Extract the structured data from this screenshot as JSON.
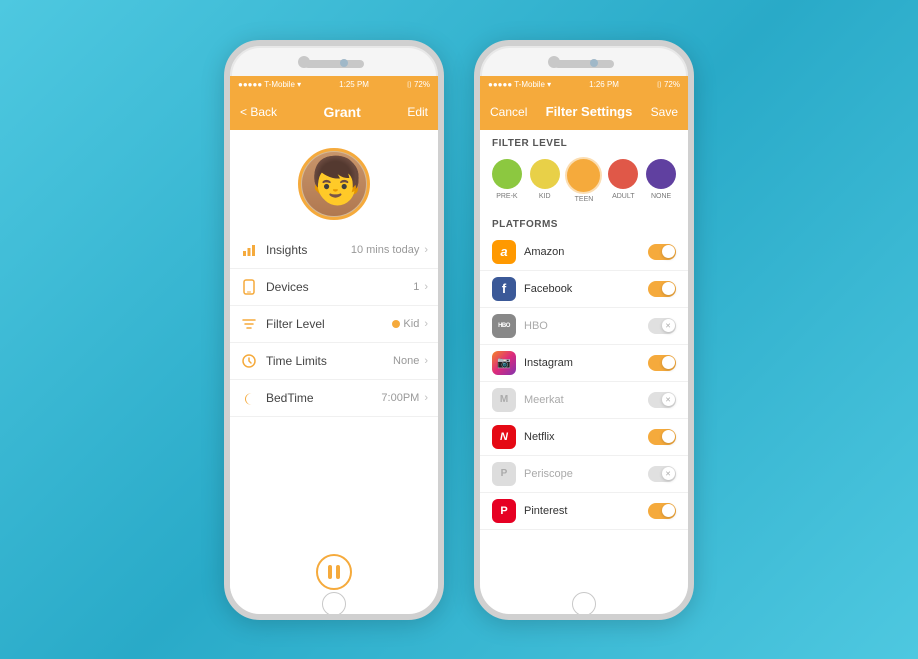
{
  "background": "#4ec8e0",
  "phone_left": {
    "status_bar": {
      "carrier": "●●●●● T-Mobile ▾",
      "time": "1:25 PM",
      "battery": "⌷ 72%"
    },
    "nav": {
      "back_label": "< Back",
      "title": "Grant",
      "action": "Edit"
    },
    "profile_name": "Grant",
    "menu_items": [
      {
        "icon": "chart-icon",
        "label": "Insights",
        "value": "10 mins today",
        "has_chevron": true
      },
      {
        "icon": "phone-icon",
        "label": "Devices",
        "value": "1",
        "has_chevron": true
      },
      {
        "icon": "filter-icon",
        "label": "Filter Level",
        "value": "Kid",
        "has_dot": true,
        "has_chevron": true
      },
      {
        "icon": "clock-icon",
        "label": "Time Limits",
        "value": "None",
        "has_chevron": true
      },
      {
        "icon": "moon-icon",
        "label": "BedTime",
        "value": "7:00PM",
        "has_chevron": true
      }
    ]
  },
  "phone_right": {
    "status_bar": {
      "carrier": "●●●●● T-Mobile ▾",
      "time": "1:26 PM",
      "battery": "⌷ 72%"
    },
    "nav": {
      "cancel_label": "Cancel",
      "title": "Filter Settings",
      "save_label": "Save"
    },
    "filter_level_header": "FILTER LEVEL",
    "levels": [
      {
        "id": "pre-k",
        "label": "PRE-K",
        "color": "#8cc840",
        "selected": false
      },
      {
        "id": "kid",
        "label": "KID",
        "color": "#e8d048",
        "selected": false
      },
      {
        "id": "teen",
        "label": "TEEN",
        "color": "#f5aa3c",
        "selected": true
      },
      {
        "id": "adult",
        "label": "ADULT",
        "color": "#e05848",
        "selected": false
      },
      {
        "id": "none",
        "label": "NONE",
        "color": "#6040a0",
        "selected": false
      }
    ],
    "platforms_header": "PLATFORMS",
    "platforms": [
      {
        "name": "Amazon",
        "icon_text": "a",
        "icon_bg": "#ff9900",
        "enabled": true,
        "disabled": false
      },
      {
        "name": "Facebook",
        "icon_text": "f",
        "icon_bg": "#3b5998",
        "enabled": true,
        "disabled": false
      },
      {
        "name": "HBO",
        "icon_text": "HBO",
        "icon_bg": "#aaaaaa",
        "enabled": false,
        "disabled": true
      },
      {
        "name": "Instagram",
        "icon_text": "📷",
        "icon_bg": "#c13584",
        "enabled": true,
        "disabled": false
      },
      {
        "name": "Meerkat",
        "icon_text": "M",
        "icon_bg": "#cccccc",
        "enabled": false,
        "disabled": true
      },
      {
        "name": "Netflix",
        "icon_text": "N",
        "icon_bg": "#e50914",
        "enabled": true,
        "disabled": false
      },
      {
        "name": "Periscope",
        "icon_text": "P",
        "icon_bg": "#cccccc",
        "enabled": false,
        "disabled": true
      },
      {
        "name": "Pinterest",
        "icon_text": "P",
        "icon_bg": "#e60023",
        "enabled": true,
        "disabled": false
      }
    ]
  }
}
